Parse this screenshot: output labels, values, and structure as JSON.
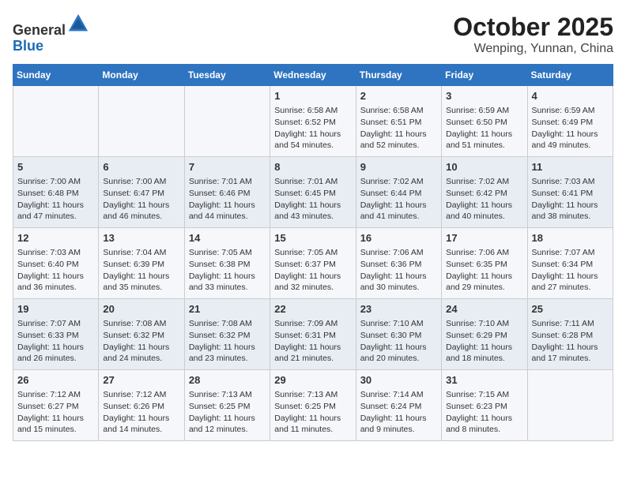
{
  "header": {
    "logo_line1": "General",
    "logo_line2": "Blue",
    "month": "October 2025",
    "location": "Wenping, Yunnan, China"
  },
  "weekdays": [
    "Sunday",
    "Monday",
    "Tuesday",
    "Wednesday",
    "Thursday",
    "Friday",
    "Saturday"
  ],
  "weeks": [
    [
      {
        "day": "",
        "info": ""
      },
      {
        "day": "",
        "info": ""
      },
      {
        "day": "",
        "info": ""
      },
      {
        "day": "1",
        "info": "Sunrise: 6:58 AM\nSunset: 6:52 PM\nDaylight: 11 hours\nand 54 minutes."
      },
      {
        "day": "2",
        "info": "Sunrise: 6:58 AM\nSunset: 6:51 PM\nDaylight: 11 hours\nand 52 minutes."
      },
      {
        "day": "3",
        "info": "Sunrise: 6:59 AM\nSunset: 6:50 PM\nDaylight: 11 hours\nand 51 minutes."
      },
      {
        "day": "4",
        "info": "Sunrise: 6:59 AM\nSunset: 6:49 PM\nDaylight: 11 hours\nand 49 minutes."
      }
    ],
    [
      {
        "day": "5",
        "info": "Sunrise: 7:00 AM\nSunset: 6:48 PM\nDaylight: 11 hours\nand 47 minutes."
      },
      {
        "day": "6",
        "info": "Sunrise: 7:00 AM\nSunset: 6:47 PM\nDaylight: 11 hours\nand 46 minutes."
      },
      {
        "day": "7",
        "info": "Sunrise: 7:01 AM\nSunset: 6:46 PM\nDaylight: 11 hours\nand 44 minutes."
      },
      {
        "day": "8",
        "info": "Sunrise: 7:01 AM\nSunset: 6:45 PM\nDaylight: 11 hours\nand 43 minutes."
      },
      {
        "day": "9",
        "info": "Sunrise: 7:02 AM\nSunset: 6:44 PM\nDaylight: 11 hours\nand 41 minutes."
      },
      {
        "day": "10",
        "info": "Sunrise: 7:02 AM\nSunset: 6:42 PM\nDaylight: 11 hours\nand 40 minutes."
      },
      {
        "day": "11",
        "info": "Sunrise: 7:03 AM\nSunset: 6:41 PM\nDaylight: 11 hours\nand 38 minutes."
      }
    ],
    [
      {
        "day": "12",
        "info": "Sunrise: 7:03 AM\nSunset: 6:40 PM\nDaylight: 11 hours\nand 36 minutes."
      },
      {
        "day": "13",
        "info": "Sunrise: 7:04 AM\nSunset: 6:39 PM\nDaylight: 11 hours\nand 35 minutes."
      },
      {
        "day": "14",
        "info": "Sunrise: 7:05 AM\nSunset: 6:38 PM\nDaylight: 11 hours\nand 33 minutes."
      },
      {
        "day": "15",
        "info": "Sunrise: 7:05 AM\nSunset: 6:37 PM\nDaylight: 11 hours\nand 32 minutes."
      },
      {
        "day": "16",
        "info": "Sunrise: 7:06 AM\nSunset: 6:36 PM\nDaylight: 11 hours\nand 30 minutes."
      },
      {
        "day": "17",
        "info": "Sunrise: 7:06 AM\nSunset: 6:35 PM\nDaylight: 11 hours\nand 29 minutes."
      },
      {
        "day": "18",
        "info": "Sunrise: 7:07 AM\nSunset: 6:34 PM\nDaylight: 11 hours\nand 27 minutes."
      }
    ],
    [
      {
        "day": "19",
        "info": "Sunrise: 7:07 AM\nSunset: 6:33 PM\nDaylight: 11 hours\nand 26 minutes."
      },
      {
        "day": "20",
        "info": "Sunrise: 7:08 AM\nSunset: 6:32 PM\nDaylight: 11 hours\nand 24 minutes."
      },
      {
        "day": "21",
        "info": "Sunrise: 7:08 AM\nSunset: 6:32 PM\nDaylight: 11 hours\nand 23 minutes."
      },
      {
        "day": "22",
        "info": "Sunrise: 7:09 AM\nSunset: 6:31 PM\nDaylight: 11 hours\nand 21 minutes."
      },
      {
        "day": "23",
        "info": "Sunrise: 7:10 AM\nSunset: 6:30 PM\nDaylight: 11 hours\nand 20 minutes."
      },
      {
        "day": "24",
        "info": "Sunrise: 7:10 AM\nSunset: 6:29 PM\nDaylight: 11 hours\nand 18 minutes."
      },
      {
        "day": "25",
        "info": "Sunrise: 7:11 AM\nSunset: 6:28 PM\nDaylight: 11 hours\nand 17 minutes."
      }
    ],
    [
      {
        "day": "26",
        "info": "Sunrise: 7:12 AM\nSunset: 6:27 PM\nDaylight: 11 hours\nand 15 minutes."
      },
      {
        "day": "27",
        "info": "Sunrise: 7:12 AM\nSunset: 6:26 PM\nDaylight: 11 hours\nand 14 minutes."
      },
      {
        "day": "28",
        "info": "Sunrise: 7:13 AM\nSunset: 6:25 PM\nDaylight: 11 hours\nand 12 minutes."
      },
      {
        "day": "29",
        "info": "Sunrise: 7:13 AM\nSunset: 6:25 PM\nDaylight: 11 hours\nand 11 minutes."
      },
      {
        "day": "30",
        "info": "Sunrise: 7:14 AM\nSunset: 6:24 PM\nDaylight: 11 hours\nand 9 minutes."
      },
      {
        "day": "31",
        "info": "Sunrise: 7:15 AM\nSunset: 6:23 PM\nDaylight: 11 hours\nand 8 minutes."
      },
      {
        "day": "",
        "info": ""
      }
    ]
  ]
}
